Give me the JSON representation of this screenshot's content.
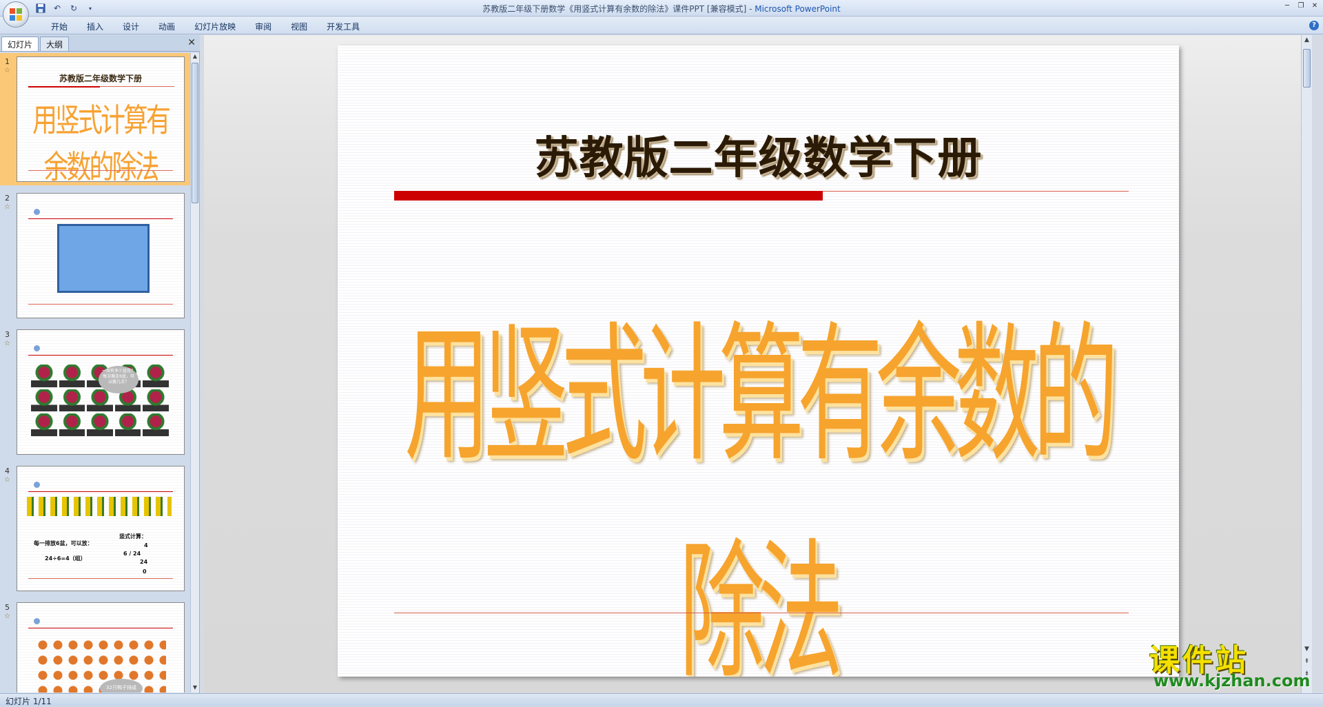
{
  "window": {
    "title_prefix": "苏教版二年级下册数学《用竖式计算有余数的除法》课件PPT [兼容模式] - ",
    "title_app": "Microsoft PowerPoint"
  },
  "quick_access": {
    "save_icon": "save-icon",
    "undo_icon": "undo-icon",
    "redo_icon": "redo-icon",
    "customize_icon": "dropdown-icon"
  },
  "ribbon": {
    "tabs": [
      "开始",
      "插入",
      "设计",
      "动画",
      "幻灯片放映",
      "审阅",
      "视图",
      "开发工具"
    ]
  },
  "left_pane": {
    "tab_slides": "幻灯片",
    "tab_outline": "大纲",
    "thumbnails": [
      {
        "num": "1",
        "title": "苏教版二年级数学下册",
        "big": "用竖式计算有余数的除法"
      },
      {
        "num": "2"
      },
      {
        "num": "3",
        "bubble": "一共有多少盆花？每次搬走6盆，可以搬几次？"
      },
      {
        "num": "4",
        "line1": "每一排放6盆，可以放：",
        "line2": "24÷6=4（组）",
        "line3": "竖式计算：",
        "d1": "4",
        "d2": "6 / 24",
        "d3": "24",
        "d4": "0"
      },
      {
        "num": "5",
        "bubble": "32只鸭子排成"
      }
    ]
  },
  "slide": {
    "title": "苏教版二年级数学下册",
    "main": "用竖式计算有余数的除法"
  },
  "watermark": {
    "big": "课件站",
    "url": "www.kjzhan.com"
  },
  "status": {
    "slide_info": "幻灯片 1/11"
  },
  "colors": {
    "accent_red": "#cc0000",
    "title_orange": "#f6a42e",
    "selected_thumb": "#fbc877"
  }
}
